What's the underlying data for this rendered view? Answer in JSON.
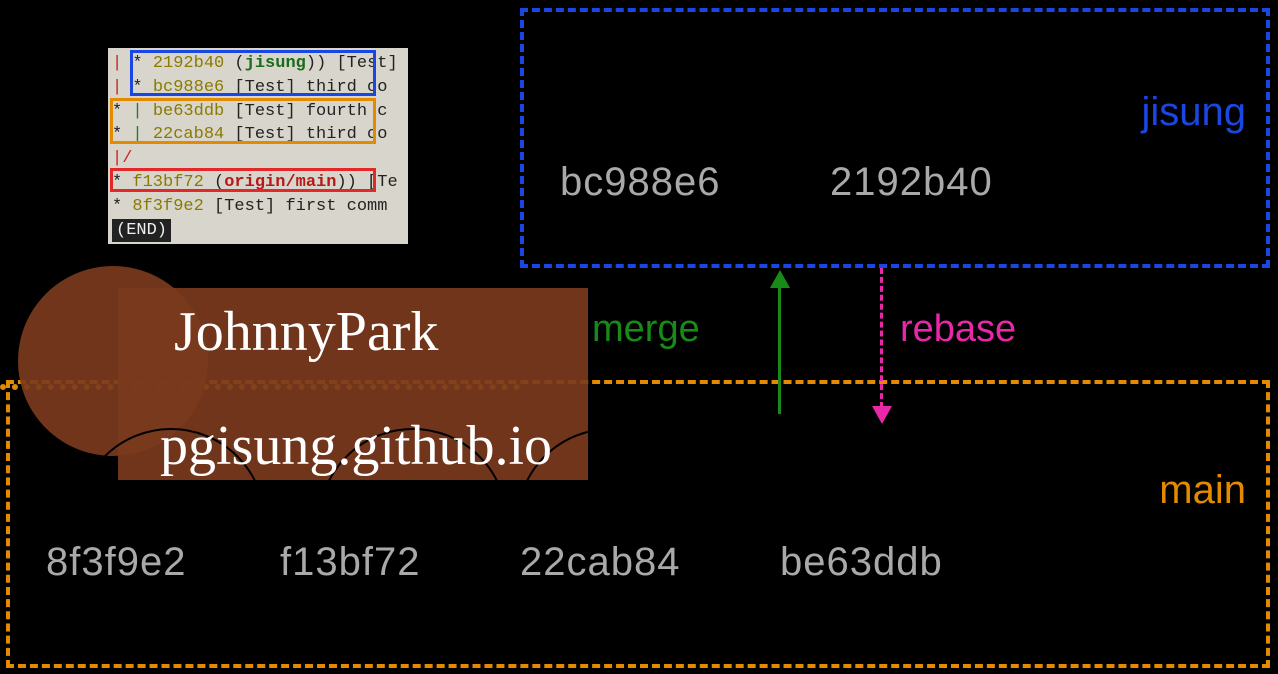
{
  "terminal": {
    "rows": [
      {
        "graph": "| * ",
        "hash": "2192b40",
        "rest": " (",
        "branch": "jisung",
        "rest2": ") [Test]"
      },
      {
        "graph": "| * ",
        "hash": "bc988e6",
        "rest": " [Test] third co"
      },
      {
        "graph": "* | ",
        "hash": "be63ddb",
        "rest": " [Test] fourth c"
      },
      {
        "graph": "* | ",
        "hash": "22cab84",
        "rest": " [Test] third co"
      },
      {
        "graph": "|/"
      },
      {
        "graph": "* ",
        "hash": "f13bf72",
        "rest": " (",
        "origin": "origin/main",
        "rest2": ") [Te"
      },
      {
        "graph": "* ",
        "hash": "8f3f9e2",
        "rest": " [Test] first comm"
      }
    ],
    "end": "(END)"
  },
  "branches": {
    "jisung": "jisung",
    "main": "main"
  },
  "jisung_commits": [
    "bc988e6",
    "2192b40"
  ],
  "main_commits": [
    "8f3f9e2",
    "f13bf72",
    "22cab84",
    "be63ddb"
  ],
  "labels": {
    "merge": "merge",
    "rebase": "rebase"
  },
  "watermark": {
    "name": "JohnnyPark",
    "url": "pgisung.github.io"
  }
}
